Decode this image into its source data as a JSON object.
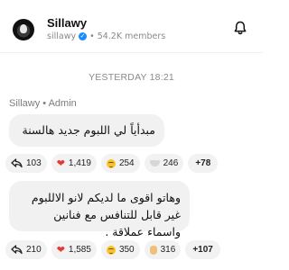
{
  "channel": {
    "name": "Sillawy",
    "handle": "sillawy",
    "separator_dot": "•",
    "members": "54.2K members",
    "verified_icon": "verified-icon",
    "bell_icon": "bell-icon"
  },
  "feed": {
    "date_label": "YESTERDAY 18:21",
    "sender": "Sillawy • Admin",
    "messages": [
      {
        "text": "مبدأياً لي اللبوم جديد هالسنة .",
        "reactions": [
          {
            "icon": "share-icon",
            "count": "103"
          },
          {
            "icon": "heart-icon",
            "count": "1,419"
          },
          {
            "icon": "grin-icon",
            "count": "254"
          },
          {
            "icon": "drop-icon",
            "count": "246"
          }
        ],
        "more": "+78"
      },
      {
        "text": "وهاتو اقوى ما لديكم لانو الاللبوم غير قابل للتنافس مع فنانين واسماء عملاقة .",
        "reactions": [
          {
            "icon": "share-icon",
            "count": "210"
          },
          {
            "icon": "heart-icon",
            "count": "1,585"
          },
          {
            "icon": "grin-icon",
            "count": "350"
          },
          {
            "icon": "clap-icon",
            "count": "316"
          }
        ],
        "more": "+107"
      }
    ]
  },
  "colors": {
    "accent": "#1a8cff",
    "bubble": "#f1f1f1",
    "chip": "#f2f2f2",
    "heart": "#e53935",
    "muted_text": "#8a8a8a"
  }
}
